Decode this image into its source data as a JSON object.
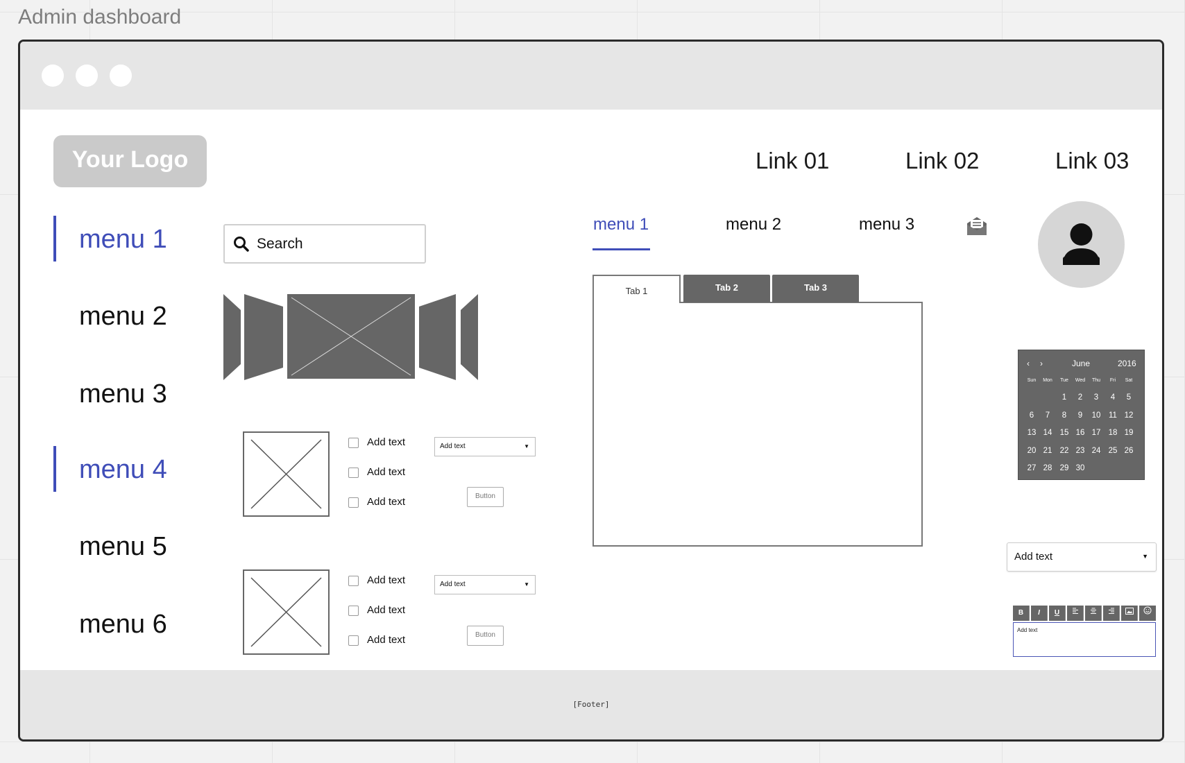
{
  "board": {
    "title": "Admin dashboard"
  },
  "header": {
    "logo": "Your Logo",
    "links": [
      "Link 01",
      "Link 02",
      "Link 03"
    ]
  },
  "sidebar": {
    "items": [
      {
        "label": "menu 1",
        "active": true
      },
      {
        "label": "menu 2",
        "active": false
      },
      {
        "label": "menu 3",
        "active": false
      },
      {
        "label": "menu 4",
        "active": true
      },
      {
        "label": "menu 5",
        "active": false
      },
      {
        "label": "menu 6",
        "active": false
      }
    ]
  },
  "search": {
    "placeholder": "Search",
    "icon": "search-icon"
  },
  "content_rows": [
    {
      "checkboxes": [
        "Add text",
        "Add text",
        "Add text"
      ],
      "select": "Add text",
      "button": "Button"
    },
    {
      "checkboxes": [
        "Add text",
        "Add text",
        "Add text"
      ],
      "select": "Add text",
      "button": "Button"
    }
  ],
  "tab_menu": {
    "items": [
      "menu 1",
      "menu 2",
      "menu 3"
    ],
    "active_index": 0,
    "mail_icon": "mail-open-icon"
  },
  "tabs": {
    "items": [
      "Tab 1",
      "Tab 2",
      "Tab 3"
    ],
    "active_index": 0
  },
  "calendar": {
    "month": "June",
    "year": "2016",
    "weekdays": [
      "Sun",
      "Mon",
      "Tue",
      "Wed",
      "Thu",
      "Fri",
      "Sat"
    ],
    "days": [
      "1",
      "2",
      "3",
      "4",
      "5",
      "6",
      "7",
      "8",
      "9",
      "10",
      "11",
      "12",
      "13",
      "14",
      "15",
      "16",
      "17",
      "18",
      "19",
      "20",
      "21",
      "22",
      "23",
      "24",
      "25",
      "26",
      "27",
      "28",
      "29",
      "30"
    ],
    "first_weekday_index": 2
  },
  "dropdown": {
    "value": "Add text"
  },
  "rich_text": {
    "toolbar": [
      "B",
      "I",
      "U",
      "align-left",
      "align-center",
      "align-right",
      "image",
      "emoji"
    ],
    "value": "Add text"
  },
  "footer": {
    "text": "[Footer]"
  },
  "colors": {
    "accent": "#3f4db8",
    "chrome": "#e6e6e6",
    "dark_gray": "#666666"
  }
}
